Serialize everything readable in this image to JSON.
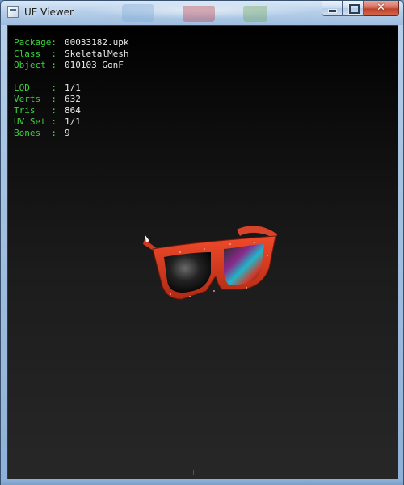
{
  "window": {
    "title": "UE Viewer",
    "controls": {
      "minimize": "minimize",
      "maximize": "maximize",
      "close": "✕"
    }
  },
  "info": {
    "package_label": "Package:",
    "package_value": "00033182.upk",
    "class_label": "Class  :",
    "class_value": "SkeletalMesh",
    "object_label": "Object :",
    "object_value": "010103_GonF",
    "lod_label": "LOD    :",
    "lod_value": "1/1",
    "verts_label": "Verts  :",
    "verts_value": "632",
    "tris_label": "Tris   :",
    "tris_value": "864",
    "uvset_label": "UV Set :",
    "uvset_value": "1/1",
    "bones_label": "Bones  :",
    "bones_value": "9"
  },
  "colors": {
    "label_green": "#3cd23c",
    "value_white": "#e8e8e8",
    "frame_red": "#c8321a",
    "background": "#000000"
  },
  "icons": {
    "app": "app-window-icon",
    "mesh": "sunglasses-mesh"
  }
}
